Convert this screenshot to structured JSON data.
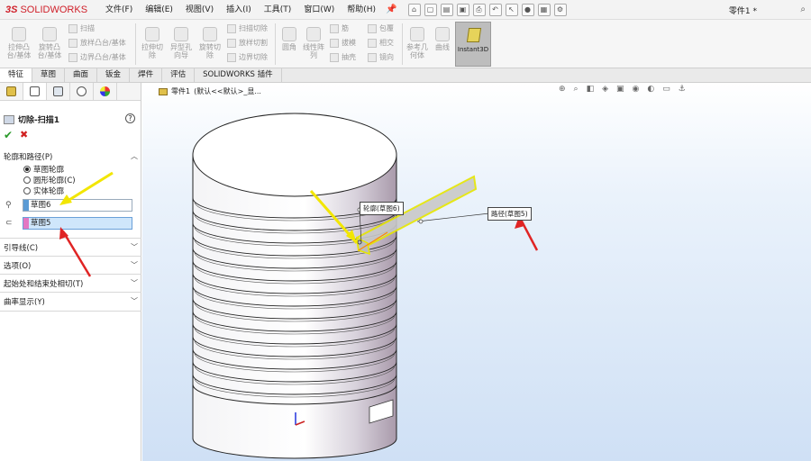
{
  "app": {
    "logo_prefix": "3S",
    "logo_name": "SOLIDWORKS",
    "menus": [
      "文件(F)",
      "编辑(E)",
      "视图(V)",
      "插入(I)",
      "工具(T)",
      "窗口(W)",
      "帮助(H)"
    ],
    "document_title": "零件1 *"
  },
  "ribbon": {
    "big_buttons": [
      {
        "label": "拉伸凸\n台/基体"
      },
      {
        "label": "旋转凸\n台/基体"
      },
      {
        "label": "拉伸切\n除"
      },
      {
        "label": "异型孔\n向导"
      },
      {
        "label": "旋转切\n除"
      },
      {
        "label": "圆角"
      },
      {
        "label": "线性阵\n列"
      },
      {
        "label": "参考几\n何体"
      },
      {
        "label": "曲线"
      }
    ],
    "small_buttons": [
      "扫描",
      "放样凸台/基体",
      "边界凸台/基体",
      "扫描切除",
      "放样切割",
      "边界切除",
      "筋",
      "拔模",
      "抽壳",
      "包覆",
      "相交",
      "镜向"
    ],
    "instant3d_label": "Instant3D"
  },
  "tabs": [
    "特征",
    "草图",
    "曲面",
    "钣金",
    "焊件",
    "评估",
    "SOLIDWORKS 插件"
  ],
  "active_tab": 0,
  "panel": {
    "title": "切除-扫描1",
    "help": "?",
    "ok": "✔",
    "cancel": "✖",
    "section_profile": "轮廓和路径(P)",
    "radios": [
      {
        "label": "草图轮廓",
        "checked": true
      },
      {
        "label": "圆形轮廓(C)",
        "checked": false
      },
      {
        "label": "实体轮廓",
        "checked": false
      }
    ],
    "profile_field": "草图6",
    "path_field": "草图5",
    "profile_color": "#5b9bd5",
    "path_color": "#e377c2",
    "sections": [
      "引导线(C)",
      "选项(O)",
      "起始处和结束处相切(T)",
      "曲率显示(Y)"
    ]
  },
  "viewport": {
    "breadcrumb_part": "零件1",
    "breadcrumb_config": "(默认<<默认>_显...",
    "callout_profile": "轮廓(草图6)",
    "callout_path": "路径(草图5)"
  }
}
